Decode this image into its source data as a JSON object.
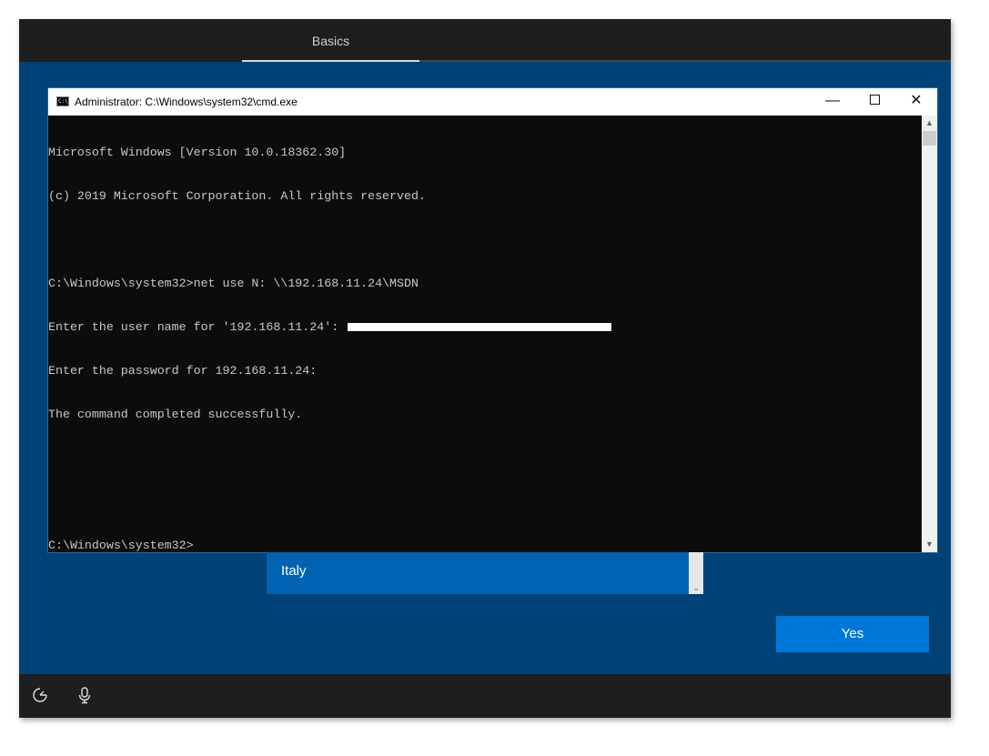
{
  "oobe": {
    "header_tab": "Basics",
    "country_value": "Italy",
    "yes_label": "Yes"
  },
  "cmd": {
    "icon_text": "C:\\",
    "title": "Administrator: C:\\Windows\\system32\\cmd.exe",
    "minimize_glyph": "—",
    "close_glyph": "✕",
    "lines": [
      "Microsoft Windows [Version 10.0.18362.30]",
      "(c) 2019 Microsoft Corporation. All rights reserved.",
      "",
      "C:\\Windows\\system32>net use N: \\\\192.168.11.24\\MSDN",
      "Enter the user name for '192.168.11.24': ",
      "Enter the password for 192.168.11.24:",
      "The command completed successfully.",
      "",
      "",
      "C:\\Windows\\system32>"
    ]
  },
  "icons": {
    "ease_of_access": "ease-of-access-icon",
    "microphone": "microphone-icon",
    "scroll_up": "▲",
    "scroll_down": "▼",
    "dropdown_chevron": "⌄"
  },
  "colors": {
    "oobe_background": "#004275",
    "bar_background": "#1e1e1e",
    "accent": "#0078d7",
    "dropdown_background": "#0063b1",
    "console_background": "#0c0c0c",
    "console_text": "#c8c8c8"
  }
}
